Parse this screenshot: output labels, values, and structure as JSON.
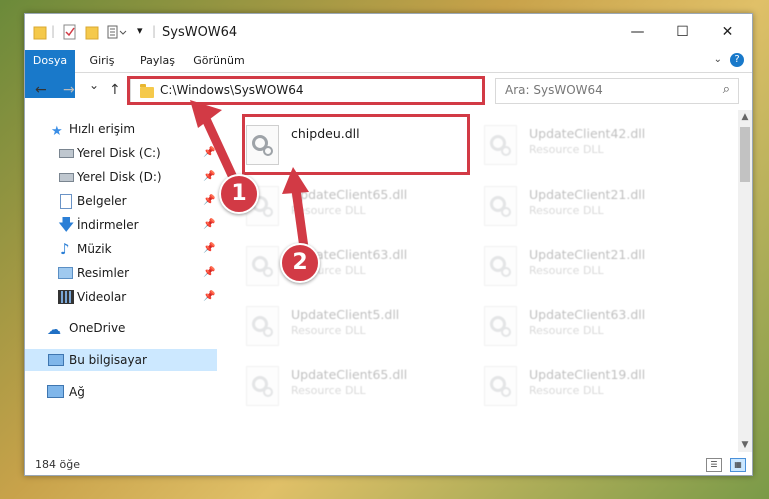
{
  "window": {
    "title": "SysWOW64",
    "controls": {
      "minimize": "—",
      "maximize": "☐",
      "close": "✕"
    }
  },
  "ribbon": {
    "tabs": [
      "Dosya",
      "Giriş",
      "Paylaş",
      "Görünüm"
    ],
    "help": "?"
  },
  "nav": {
    "back": "←",
    "forward": "→",
    "recent": "⌄",
    "up": "↑",
    "address": "C:\\Windows\\SysWOW64",
    "refresh": "↻",
    "search_placeholder": "Ara: SysWOW64"
  },
  "sidebar": {
    "items": [
      {
        "label": "Hızlı erişim",
        "icon": "star-icon",
        "pinned": false
      },
      {
        "label": "Yerel Disk (C:)",
        "icon": "drive-icon",
        "pinned": true
      },
      {
        "label": "Yerel Disk (D:)",
        "icon": "drive-icon",
        "pinned": true
      },
      {
        "label": "Belgeler",
        "icon": "documents-icon",
        "pinned": true
      },
      {
        "label": "İndirmeler",
        "icon": "download-icon",
        "pinned": true
      },
      {
        "label": "Müzik",
        "icon": "music-icon",
        "pinned": true
      },
      {
        "label": "Resimler",
        "icon": "pictures-icon",
        "pinned": true
      },
      {
        "label": "Videolar",
        "icon": "video-icon",
        "pinned": true
      },
      {
        "label": "OneDrive",
        "icon": "cloud-icon",
        "pinned": false
      },
      {
        "label": "Bu bilgisayar",
        "icon": "computer-icon",
        "pinned": false,
        "selected": true
      },
      {
        "label": "Ağ",
        "icon": "network-icon",
        "pinned": false
      }
    ]
  },
  "files": [
    {
      "name": "chipdeu.dll",
      "type": ""
    },
    {
      "name": "UpdateClient42.dll",
      "type": "Resource DLL"
    },
    {
      "name": "UpdateClient65.dll",
      "type": "Resource DLL"
    },
    {
      "name": "UpdateClient21.dll",
      "type": "Resource DLL"
    },
    {
      "name": "UpdateClient63.dll",
      "type": "Resource DLL"
    },
    {
      "name": "UpdateClient21.dll",
      "type": "Resource DLL"
    },
    {
      "name": "UpdateClient5.dll",
      "type": "Resource DLL"
    },
    {
      "name": "UpdateClient63.dll",
      "type": "Resource DLL"
    },
    {
      "name": "UpdateClient65.dll",
      "type": "Resource DLL"
    },
    {
      "name": "UpdateClient19.dll",
      "type": "Resource DLL"
    }
  ],
  "status": {
    "count": "184 öğe"
  },
  "callouts": [
    "1",
    "2"
  ],
  "colors": {
    "accent": "#1979ca",
    "highlight": "#d23a45",
    "selected": "#cce8ff"
  }
}
